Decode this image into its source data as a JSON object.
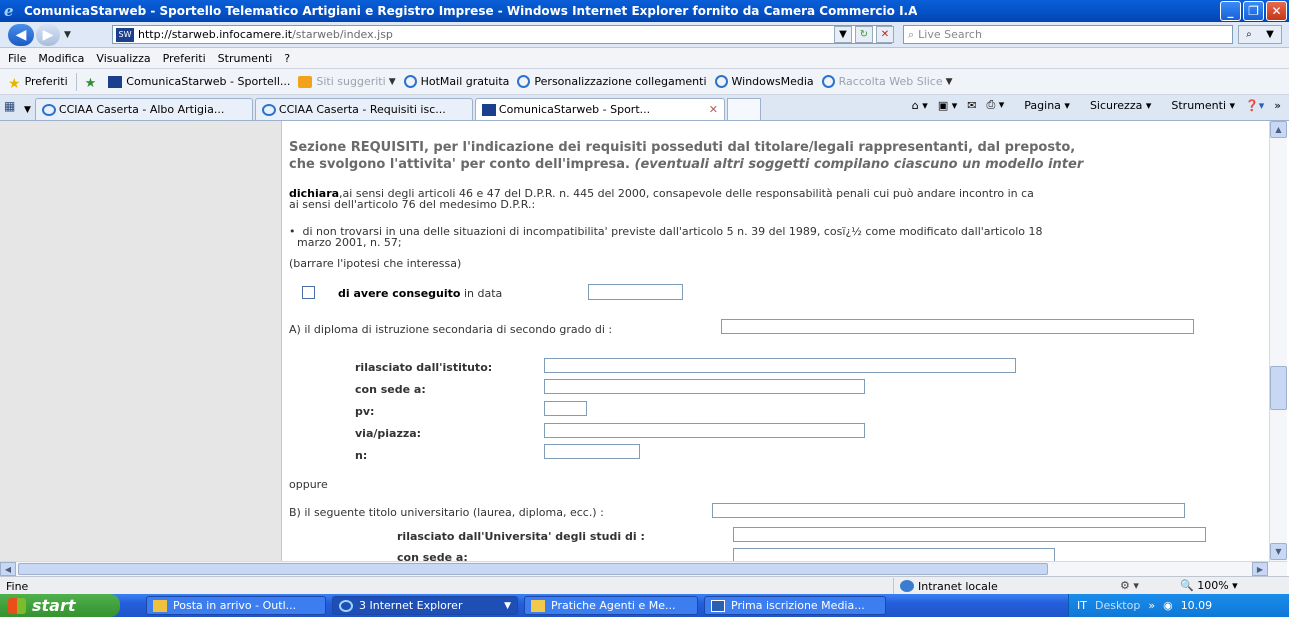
{
  "window": {
    "title": "ComunicaStarweb - Sportello Telematico Artigiani e Registro Imprese - Windows Internet Explorer fornito da Camera Commercio I.A"
  },
  "address": {
    "url_host": "http://starweb.infocamere.it",
    "url_path": "/starweb/index.jsp",
    "search_placeholder": "Live Search"
  },
  "menu": [
    "File",
    "Modifica",
    "Visualizza",
    "Preferiti",
    "Strumenti",
    "?"
  ],
  "favorites": {
    "label": "Preferiti",
    "items": [
      {
        "label": "ComunicaStarweb - Sportell...",
        "icon": "starweb-icon"
      },
      {
        "label": "Siti suggeriti",
        "icon": "suggested-sites-icon"
      },
      {
        "label": "HotMail gratuita",
        "icon": "ie-icon"
      },
      {
        "label": "Personalizzazione collegamenti",
        "icon": "ie-icon"
      },
      {
        "label": "WindowsMedia",
        "icon": "ie-icon"
      },
      {
        "label": "Raccolta Web Slice",
        "icon": "ie-icon"
      }
    ]
  },
  "tabs": [
    {
      "label": "CCIAA Caserta - Albo Artigia..."
    },
    {
      "label": "CCIAA Caserta - Requisiti isc..."
    },
    {
      "label": "ComunicaStarweb - Sport..."
    }
  ],
  "commands": {
    "page": "Pagina",
    "security": "Sicurezza",
    "tools": "Strumenti"
  },
  "form": {
    "section_line1": "Sezione REQUISITI, per l'indicazione dei requisiti posseduti dal titolare/legali rappresentanti, dal preposto,",
    "section_line2": "che svolgono l'attivita' per conto dell'impresa.",
    "section_line2_italic": "(eventuali altri soggetti compilano ciascuno un modello inter",
    "declare_bold": "dichiara",
    "declare_text": ",ai sensi degli articoli 46 e 47 del D.P.R. n. 445 del 2000, consapevole delle responsabilità penali cui può andare incontro in ca",
    "declare_text2": "ai sensi dell'articolo 76 del medesimo D.P.R.:",
    "bullet1": "di non trovarsi in una delle situazioni di incompatibilita' previste dall'articolo 5 n. 39 del 1989, cosï¿½ come modificato dall'articolo 18",
    "bullet1_cont": "marzo 2001, n. 57;",
    "choose": "(barrare l'ipotesi che interessa)",
    "obtained_bold": "di avere conseguito",
    "obtained_rest": "in data",
    "optA": "A) il diploma di istruzione secondaria di secondo grado di :",
    "issued_by_institute": "rilasciato dall'istituto:",
    "located_in": "con sede a:",
    "pv": "pv:",
    "street": "via/piazza:",
    "number": "n:",
    "or": "oppure",
    "optB": "B) il seguente titolo universitario (laurea, diploma, ecc.) :",
    "issued_by_university": "rilasciato dall'Universita' degli studi di :",
    "located_in_b": "con sede a:"
  },
  "status": {
    "text": "Fine",
    "zone": "Intranet locale",
    "zoom": "100%"
  },
  "taskbar": {
    "start": "start",
    "items": [
      {
        "label": "Posta in arrivo - Outl..."
      },
      {
        "label": "3 Internet Explorer"
      },
      {
        "label": "Pratiche Agenti e Me..."
      },
      {
        "label": "Prima iscrizione Media..."
      }
    ],
    "lang": "IT",
    "desktop": "Desktop",
    "clock": "10.09"
  }
}
